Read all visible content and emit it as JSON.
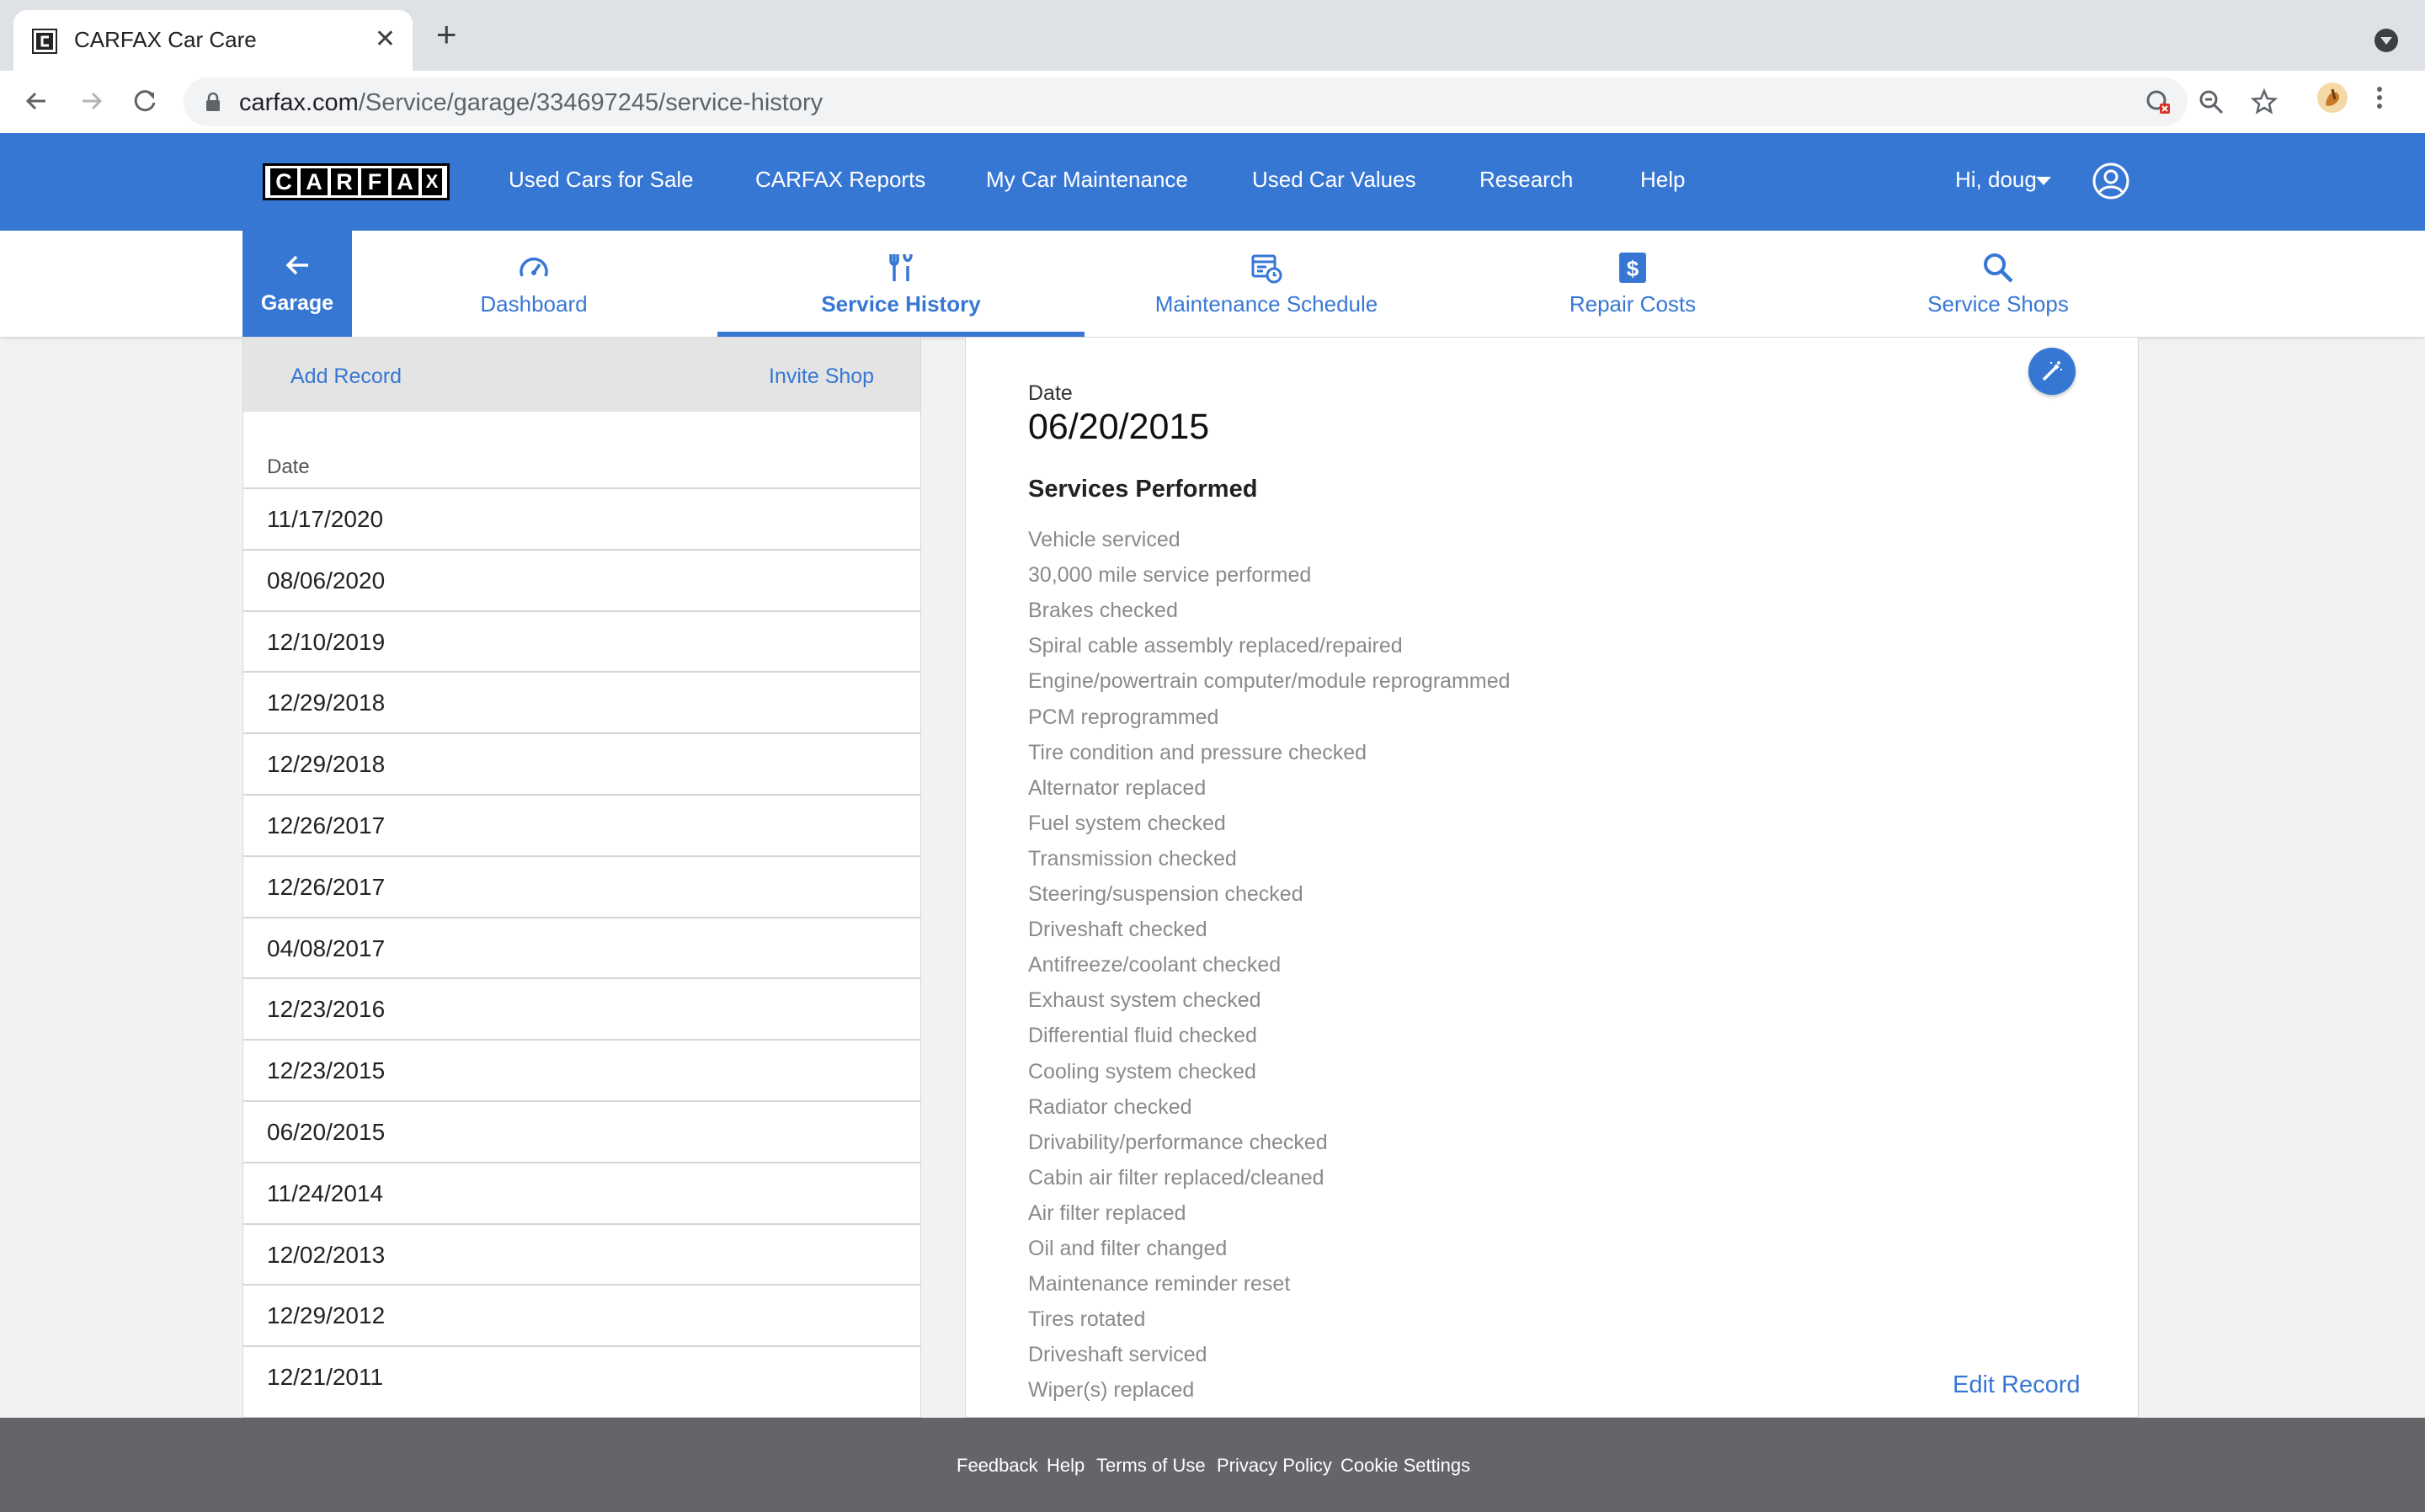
{
  "browser": {
    "tab_title": "CARFAX Car Care",
    "url_host": "carfax.com",
    "url_path": "/Service/garage/334697245/service-history"
  },
  "header": {
    "logo_letters": [
      "C",
      "A",
      "R",
      "F",
      "A",
      "X"
    ],
    "nav": [
      "Used Cars for Sale",
      "CARFAX Reports",
      "My Car Maintenance",
      "Used Car Values",
      "Research",
      "Help"
    ],
    "user_greeting": "Hi, doug"
  },
  "subnav": {
    "garage_label": "Garage",
    "items": [
      "Dashboard",
      "Service History",
      "Maintenance Schedule",
      "Repair Costs",
      "Service Shops"
    ],
    "active": "Service History"
  },
  "records_panel": {
    "add_record": "Add Record",
    "invite_shop": "Invite Shop",
    "column_header": "Date",
    "dates": [
      "11/17/2020",
      "08/06/2020",
      "12/10/2019",
      "12/29/2018",
      "12/29/2018",
      "12/26/2017",
      "12/26/2017",
      "04/08/2017",
      "12/23/2016",
      "12/23/2015",
      "06/20/2015",
      "11/24/2014",
      "12/02/2013",
      "12/29/2012",
      "12/21/2011"
    ]
  },
  "record_detail": {
    "date_label": "Date",
    "date": "06/20/2015",
    "services_heading": "Services Performed",
    "services": [
      "Vehicle serviced",
      "30,000 mile service performed",
      "Brakes checked",
      "Spiral cable assembly replaced/repaired",
      "Engine/powertrain computer/module reprogrammed",
      "PCM reprogrammed",
      "Tire condition and pressure checked",
      "Alternator replaced",
      "Fuel system checked",
      "Transmission checked",
      "Steering/suspension checked",
      "Driveshaft checked",
      "Antifreeze/coolant checked",
      "Exhaust system checked",
      "Differential fluid checked",
      "Cooling system checked",
      "Radiator checked",
      "Drivability/performance checked",
      "Cabin air filter replaced/cleaned",
      "Air filter replaced",
      "Oil and filter changed",
      "Maintenance reminder reset",
      "Tires rotated",
      "Driveshaft serviced",
      "Wiper(s) replaced"
    ],
    "edit_record": "Edit Record"
  },
  "footer": {
    "links": [
      "Feedback",
      "Help",
      "Terms of Use",
      "Privacy Policy",
      "Cookie Settings"
    ]
  },
  "colors": {
    "brand_blue": "#3777d4",
    "footer_gray": "#636569"
  }
}
